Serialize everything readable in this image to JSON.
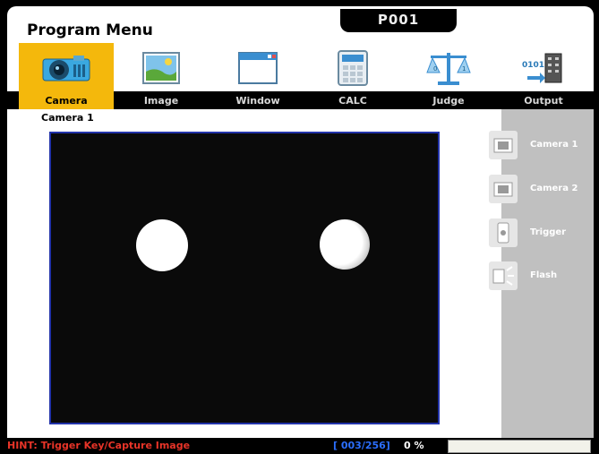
{
  "window": {
    "title": "Program Menu",
    "program": "P001"
  },
  "toolbar": {
    "icons": [
      {
        "name": "camera-icon",
        "active": true
      },
      {
        "name": "image-icon",
        "active": false
      },
      {
        "name": "window-icon",
        "active": false
      },
      {
        "name": "calc-icon",
        "active": false
      },
      {
        "name": "judge-icon",
        "active": false
      },
      {
        "name": "output-icon",
        "active": false
      }
    ]
  },
  "menu": {
    "items": [
      {
        "label": "Camera",
        "active": true
      },
      {
        "label": "Image"
      },
      {
        "label": "Window"
      },
      {
        "label": "CALC"
      },
      {
        "label": "Judge"
      },
      {
        "label": "Output"
      }
    ]
  },
  "main": {
    "camera_label": "Camera 1"
  },
  "side": {
    "items": [
      {
        "label": "Camera 1",
        "icon": "camera-icon"
      },
      {
        "label": "Camera 2",
        "icon": "camera-icon"
      },
      {
        "label": "Trigger",
        "icon": "trigger-icon"
      },
      {
        "label": "Flash",
        "icon": "flash-icon"
      }
    ]
  },
  "status": {
    "hint": "HINT: Trigger Key/Capture Image",
    "counter": "[ 003/256]",
    "percent": "0 %"
  },
  "colors": {
    "accent": "#f4b80c",
    "hint": "#e83428",
    "counter": "#2b6fff",
    "viewer_border": "#2233aa"
  }
}
